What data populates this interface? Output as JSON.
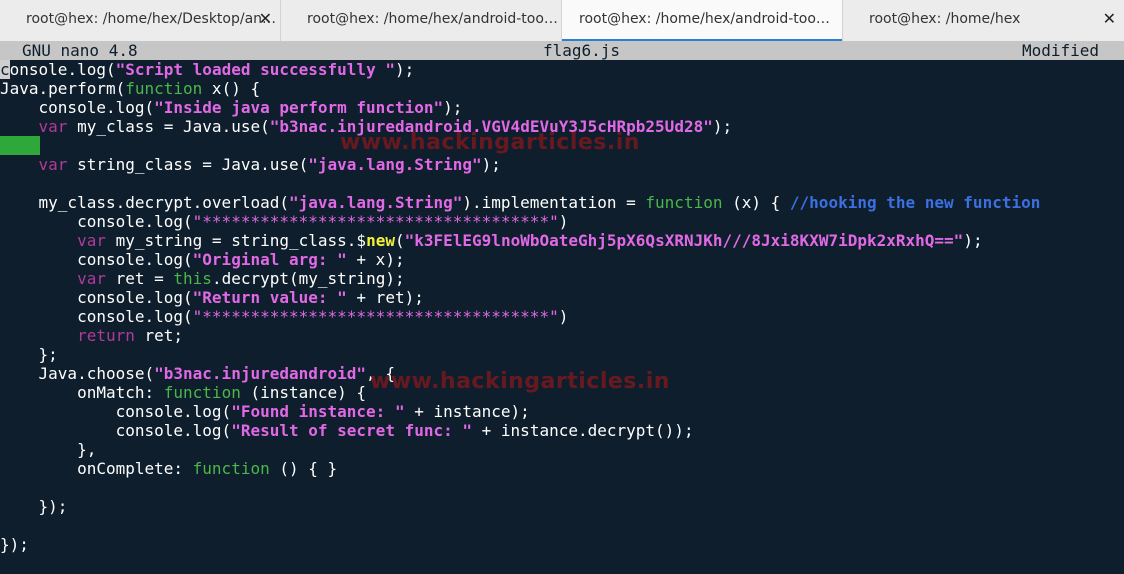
{
  "tabs": [
    {
      "title": "root@hex: /home/hex/Desktop/an…",
      "active": false
    },
    {
      "title": "root@hex: /home/hex/android-too…",
      "active": false
    },
    {
      "title": "root@hex: /home/hex/android-too…",
      "active": true
    },
    {
      "title": "root@hex: /home/hex",
      "active": false
    }
  ],
  "tab_close_glyph": "✕",
  "nano": {
    "version": "GNU nano 4.8",
    "filename": "flag6.js",
    "status": "Modified"
  },
  "code": {
    "l1_a": "onsole.log(",
    "l1_str": "\"Script loaded successfully \"",
    "l1_b": ");",
    "l2_a": "Java.perform(",
    "l2_kw": "function",
    "l2_b": " x() {",
    "l3_a": "console.log(",
    "l3_str": "\"Inside java perform function\"",
    "l3_b": ");",
    "l4_kw": "var",
    "l4_a": " my_class = Java.use(",
    "l4_str": "\"b3nac.injuredandroid.VGV4dEVuY3J5cHRpb25Ud28\"",
    "l4_b": ");",
    "l6_kw": "var",
    "l6_a": " string_class = Java.use(",
    "l6_str": "\"java.lang.String\"",
    "l6_b": ");",
    "l8_a": "my_class.decrypt.overload(",
    "l8_str": "\"java.lang.String\"",
    "l8_b": ").implementation = ",
    "l8_kw": "function",
    "l8_c": " (x) { ",
    "l8_cmt": "//hooking the new function",
    "l9_a": "console.log(",
    "l9_str": "\"************************************\"",
    "l9_b": ")",
    "l10_kw": "var",
    "l10_a": " my_string = string_class.$",
    "l10_new": "new",
    "l10_b": "(",
    "l10_str": "\"k3FElEG9lnoWbOateGhj5pX6QsXRNJKh///8Jxi8KXW7iDpk2xRxhQ==\"",
    "l10_c": ");",
    "l11_a": "console.log(",
    "l11_str": "\"Original arg: \"",
    "l11_b": " + x);",
    "l12_kw": "var",
    "l12_a": " ret = ",
    "l12_kw2": "this",
    "l12_b": ".decrypt(my_string);",
    "l13_a": "console.log(",
    "l13_str": "\"Return value: \"",
    "l13_b": " + ret);",
    "l14_a": "console.log(",
    "l14_str": "\"************************************\"",
    "l14_b": ")",
    "l15_kw": "return",
    "l15_a": " ret;",
    "l16_a": "};",
    "l17_a": "Java.choose(",
    "l17_str": "\"b3nac.injuredandroid\"",
    "l17_b": ", {",
    "l18_a": "onMatch: ",
    "l18_kw": "function",
    "l18_b": " (instance) {",
    "l19_a": "console.log(",
    "l19_str": "\"Found instance: \"",
    "l19_b": " + instance);",
    "l20_a": "console.log(",
    "l20_str": "\"Result of secret func: \"",
    "l20_b": " + instance.decrypt());",
    "l21_a": "},",
    "l22_a": "onComplete: ",
    "l22_kw": "function",
    "l22_b": " () { }",
    "l24_a": "});",
    "l26_a": "});"
  },
  "cursor_char": "c",
  "watermarks": [
    "www.hackingarticles.in",
    "www.hackingarticles.in"
  ],
  "colors": {
    "background": "#0e1e2c",
    "keyword": "#4ab74a",
    "string": "#e169e6",
    "comment": "#3c6fe0",
    "new_keyword": "#f2f03a",
    "return_keyword": "#b03a9a",
    "active_tab_indicator": "#2a7fd4"
  }
}
